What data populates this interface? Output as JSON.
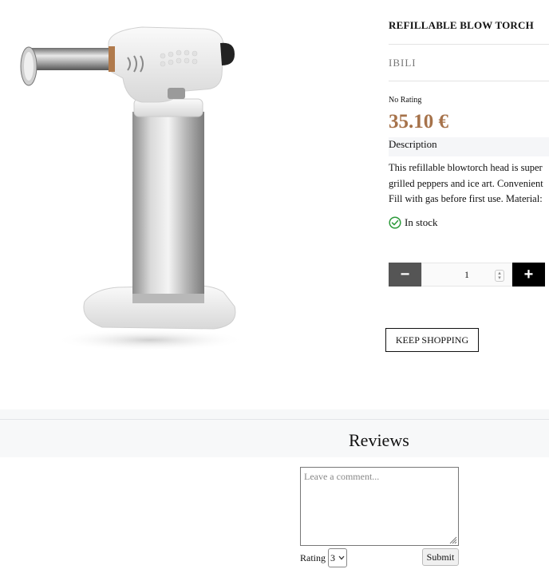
{
  "product": {
    "title": "REFILLABLE BLOW TORCH",
    "brand": "IBILI",
    "rating_text": "No Rating",
    "price": "35.10 €",
    "description_heading": "Description",
    "description_lines": [
      "This refillable blowtorch head is super",
      "grilled peppers and ice art. Convenient",
      "Fill with gas before first use. Material:"
    ],
    "stock": "In stock",
    "stock_color": "#2e9b3c",
    "price_color": "#a6724a"
  },
  "quantity": {
    "minus_icon": "minus-icon",
    "plus_icon": "plus-icon",
    "value": "1"
  },
  "actions": {
    "keep_shopping": "KEEP SHOPPING"
  },
  "reviews": {
    "title": "Reviews",
    "comment_placeholder": "Leave a comment...",
    "rating_label": "Rating",
    "rating_value": "3",
    "submit_label": "Submit"
  }
}
